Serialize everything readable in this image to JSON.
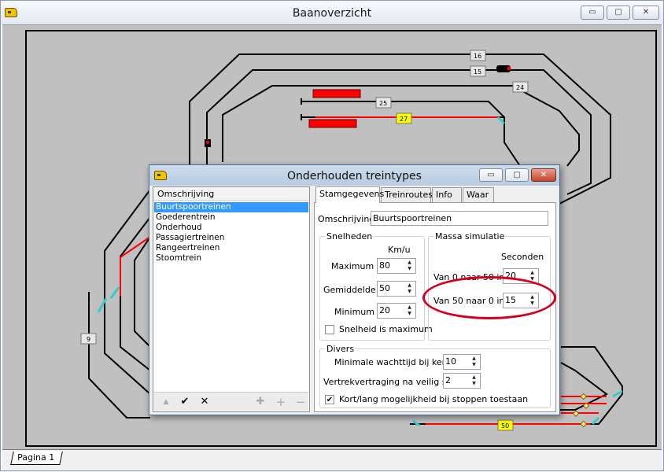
{
  "main_window": {
    "title": "Baanoverzicht",
    "icon": "train-app-icon",
    "controls": {
      "minimize": "▭",
      "maximize": "▢",
      "close": "✕"
    },
    "page_tab": "Pagina 1"
  },
  "track_plan": {
    "colors": {
      "track": "#000000",
      "route": "#ff0000",
      "switch": "#33cccc",
      "block_active": "#ffff00"
    },
    "blocks": [
      "16",
      "15",
      "24",
      "25",
      "27",
      "9",
      "50"
    ]
  },
  "dialog": {
    "title": "Onderhouden treintypes",
    "controls": {
      "minimize": "▭",
      "maximize": "▢",
      "close": "✕"
    },
    "list": {
      "header": "Omschrijving",
      "items": [
        "Buurtspoortreinen",
        "Goederentrein",
        "Onderhoud",
        "Passagiertreinen",
        "Rangeertreinen",
        "Stoomtrein"
      ],
      "selected_index": 0,
      "toolbar": {
        "up": "▲",
        "ok": "✔",
        "cancel": "✕",
        "add_many": "✚",
        "add": "+",
        "remove": "−"
      }
    },
    "tabs": [
      "Stamgegevens",
      "Treinroutes",
      "Info",
      "Waar"
    ],
    "active_tab": "Stamgegevens",
    "omschrijving": {
      "label": "Omschrijving",
      "value": "Buurtspoortreinen"
    },
    "snelheden": {
      "legend": "Snelheden",
      "unit": "Km/u",
      "maximum": {
        "label": "Maximum",
        "value": "80"
      },
      "gemiddelde": {
        "label": "Gemiddelde",
        "value": "50"
      },
      "minimum": {
        "label": "Minimum",
        "value": "20"
      },
      "is_maximum": {
        "label": "Snelheid is maximum",
        "checked": false,
        "mark": ""
      }
    },
    "massa": {
      "legend": "Massa simulatie",
      "unit": "Seconden",
      "accel": {
        "label": "Van 0 naar 50 in",
        "value": "20"
      },
      "decel": {
        "label": "Van 50 naar 0 in",
        "value": "15"
      }
    },
    "divers": {
      "legend": "Divers",
      "wacht": {
        "label": "Minimale wachttijd bij keren",
        "value": "10"
      },
      "vertrek": {
        "label": "Vertrekvertraging na veilig sein",
        "value": "2"
      },
      "kortlang": {
        "label": "Kort/lang mogelijkheid bij stoppen toestaan",
        "checked": true,
        "mark": "✔"
      }
    },
    "annotation_color": "#d6001c"
  }
}
